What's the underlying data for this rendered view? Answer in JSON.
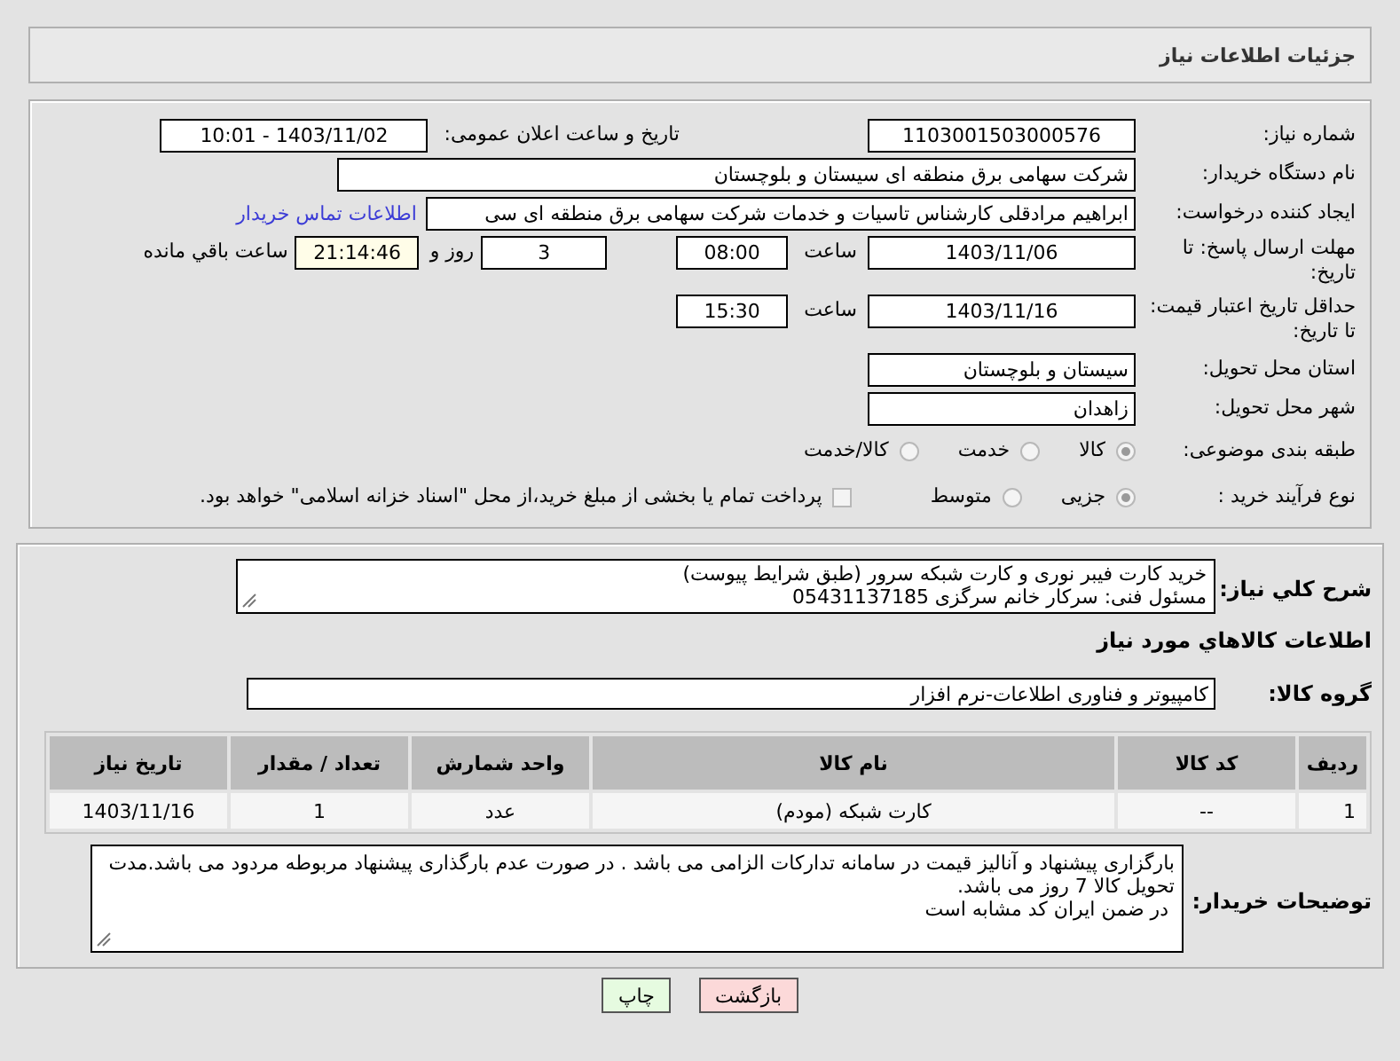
{
  "header": {
    "title": "جزئیات اطلاعات نیاز"
  },
  "need_number": {
    "label": "شماره نیاز:",
    "value": "1103001503000576"
  },
  "announce": {
    "label": "تاریخ و ساعت اعلان عمومی:",
    "value": "1403/11/02 - 10:01"
  },
  "buyer_org": {
    "label": "نام دستگاه خریدار:",
    "value": "شرکت سهامی برق منطقه ای سیستان و بلوچستان"
  },
  "requester": {
    "label": "ایجاد کننده درخواست:",
    "value": "ابراهیم مرادقلی کارشناس تاسیات و خدمات شرکت سهامی برق منطقه ای سی",
    "link": "اطلاعات تماس خریدار"
  },
  "reply_deadline": {
    "label": "مهلت ارسال پاسخ: تا تاریخ:",
    "date": "1403/11/06",
    "time_label": "ساعت",
    "time": "08:00",
    "days": "3",
    "days_label": "روز و",
    "remaining": "21:14:46",
    "remaining_label": "ساعت باقي مانده"
  },
  "price_validity": {
    "label": "حداقل تاریخ اعتبار قیمت: تا تاریخ:",
    "date": "1403/11/16",
    "time_label": "ساعت",
    "time": "15:30"
  },
  "province": {
    "label": "استان محل تحویل:",
    "value": "سیستان و بلوچستان"
  },
  "city": {
    "label": "شهر محل تحویل:",
    "value": "زاهدان"
  },
  "category": {
    "label": "طبقه بندی موضوعی:",
    "options": [
      {
        "label": "کالا",
        "selected": true
      },
      {
        "label": "خدمت",
        "selected": false
      },
      {
        "label": "کالا/خدمت",
        "selected": false
      }
    ]
  },
  "purchase_type": {
    "label": "نوع فرآیند خرید :",
    "options": [
      {
        "label": "جزیی",
        "selected": true
      },
      {
        "label": "متوسط",
        "selected": false
      }
    ],
    "payment_option": {
      "label": "پرداخت تمام یا بخشی از مبلغ خرید،از محل \"اسناد خزانه اسلامی\" خواهد بود.",
      "checked": false
    }
  },
  "description": {
    "label": "شرح کلي نياز:",
    "value": "خرید کارت فیبر نوری و کارت شبکه سرور (طبق شرایط پیوست)\nمسئول فنی: سرکار خانم سرگزی 05431137185"
  },
  "goods_heading": "اطلاعات کالاهاي مورد نياز",
  "goods_group": {
    "label": "گروه کالا:",
    "value": "کامپیوتر و فناوری اطلاعات-نرم افزار"
  },
  "table": {
    "columns": [
      "ردیف",
      "کد کالا",
      "نام کالا",
      "واحد شمارش",
      "تعداد / مقدار",
      "تاریخ نیاز"
    ],
    "rows": [
      [
        "1",
        "--",
        "کارت شبکه (مودم)",
        "عدد",
        "1",
        "1403/11/16"
      ]
    ]
  },
  "buyer_notes": {
    "label": "توضیحات خریدار:",
    "value": "بارگزاری پیشنهاد و آنالیز قیمت در سامانه تدارکات الزامی می باشد . در صورت عدم بارگذاری پیشنهاد مربوطه مردود می باشد.مدت تحویل کالا 7 روز می باشد.\n در ضمن ایران کد مشابه است"
  },
  "buttons": [
    {
      "label": "بازگشت",
      "kind": "back"
    },
    {
      "label": "چاپ",
      "kind": "print"
    }
  ]
}
